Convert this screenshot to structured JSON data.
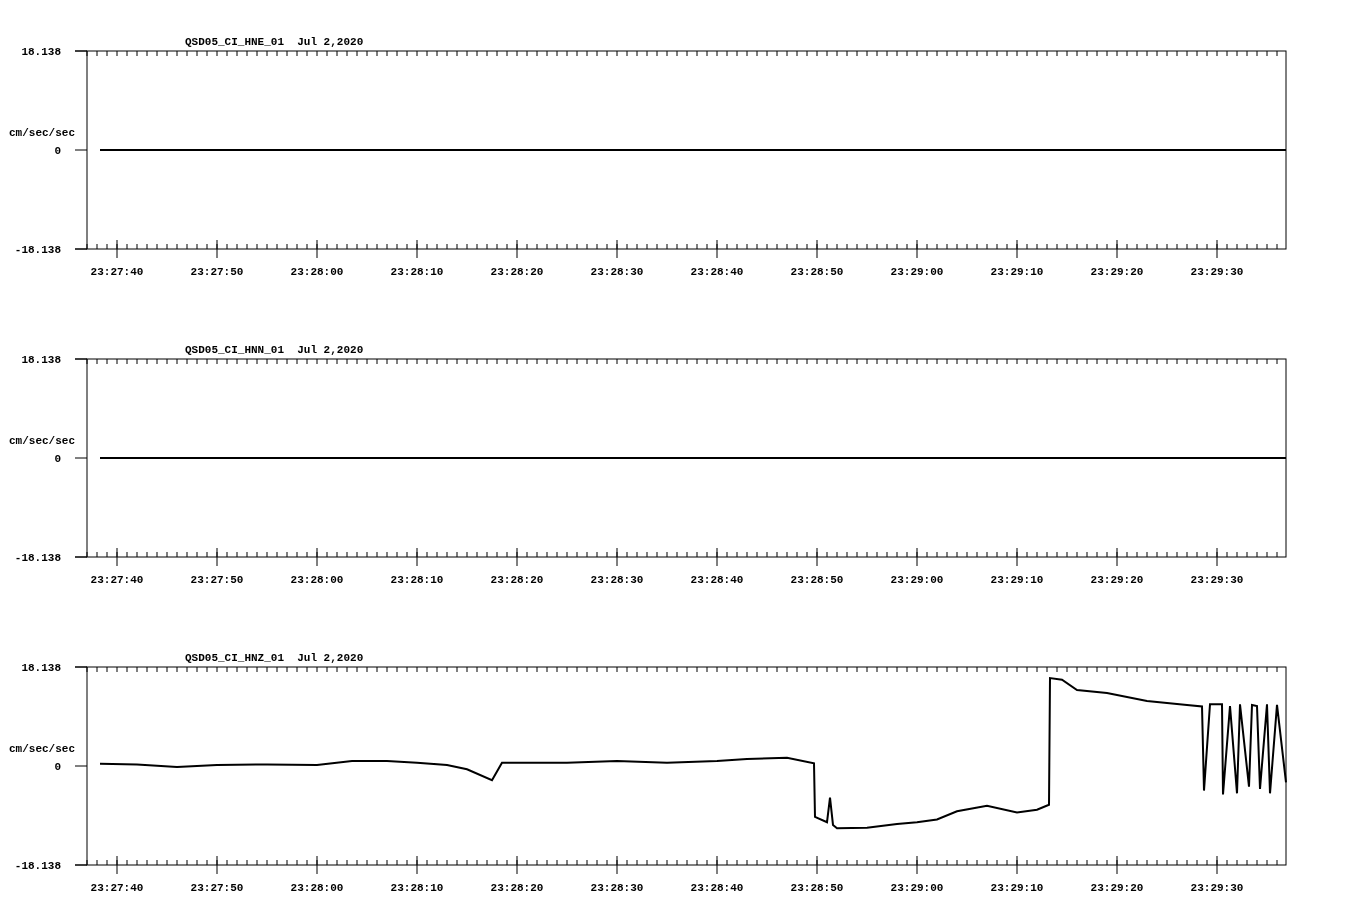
{
  "panels": [
    {
      "chart_data": {
        "type": "line",
        "title": "QSD05_CI_HNE_01  Jul 2,2020",
        "ylabel": "cm/sec/sec",
        "xlim": [
          84457,
          84576.9
        ],
        "ylim": [
          -18.138,
          18.138
        ],
        "yticks": [
          {
            "value": 18.138,
            "label": "18.138"
          },
          {
            "value": 0,
            "label": "0"
          },
          {
            "value": -18.138,
            "label": "-18.138"
          }
        ],
        "xticks": [
          {
            "value": 84460,
            "label": "23:27:40"
          },
          {
            "value": 84470,
            "label": "23:27:50"
          },
          {
            "value": 84480,
            "label": "23:28:00"
          },
          {
            "value": 84490,
            "label": "23:28:10"
          },
          {
            "value": 84500,
            "label": "23:28:20"
          },
          {
            "value": 84510,
            "label": "23:28:30"
          },
          {
            "value": 84520,
            "label": "23:28:40"
          },
          {
            "value": 84530,
            "label": "23:28:50"
          },
          {
            "value": 84540,
            "label": "23:29:00"
          },
          {
            "value": 84550,
            "label": "23:29:10"
          },
          {
            "value": 84560,
            "label": "23:29:20"
          },
          {
            "value": 84570,
            "label": "23:29:30"
          }
        ],
        "x": [
          84458.3,
          84576.9
        ],
        "series": [
          {
            "color": "#000000",
            "values": [
              0,
              0
            ]
          }
        ]
      }
    },
    {
      "chart_data": {
        "type": "line",
        "title": "QSD05_CI_HNN_01  Jul 2,2020",
        "ylabel": "cm/sec/sec",
        "xlim": [
          84457,
          84576.9
        ],
        "ylim": [
          -18.138,
          18.138
        ],
        "yticks": [
          {
            "value": 18.138,
            "label": "18.138"
          },
          {
            "value": 0,
            "label": "0"
          },
          {
            "value": -18.138,
            "label": "-18.138"
          }
        ],
        "xticks": [
          {
            "value": 84460,
            "label": "23:27:40"
          },
          {
            "value": 84470,
            "label": "23:27:50"
          },
          {
            "value": 84480,
            "label": "23:28:00"
          },
          {
            "value": 84490,
            "label": "23:28:10"
          },
          {
            "value": 84500,
            "label": "23:28:20"
          },
          {
            "value": 84510,
            "label": "23:28:30"
          },
          {
            "value": 84520,
            "label": "23:28:40"
          },
          {
            "value": 84530,
            "label": "23:28:50"
          },
          {
            "value": 84540,
            "label": "23:29:00"
          },
          {
            "value": 84550,
            "label": "23:29:10"
          },
          {
            "value": 84560,
            "label": "23:29:20"
          },
          {
            "value": 84570,
            "label": "23:29:30"
          }
        ],
        "x": [
          84458.3,
          84576.9
        ],
        "series": [
          {
            "color": "#000000",
            "values": [
              0,
              0
            ]
          }
        ]
      }
    },
    {
      "chart_data": {
        "type": "line",
        "title": "QSD05_CI_HNZ_01  Jul 2,2020",
        "ylabel": "cm/sec/sec",
        "xlim": [
          84457,
          84576.9
        ],
        "ylim": [
          -18.138,
          18.138
        ],
        "yticks": [
          {
            "value": 18.138,
            "label": "18.138"
          },
          {
            "value": 0,
            "label": "0"
          },
          {
            "value": -18.138,
            "label": "-18.138"
          }
        ],
        "xticks": [
          {
            "value": 84460,
            "label": "23:27:40"
          },
          {
            "value": 84470,
            "label": "23:27:50"
          },
          {
            "value": 84480,
            "label": "23:28:00"
          },
          {
            "value": 84490,
            "label": "23:28:10"
          },
          {
            "value": 84500,
            "label": "23:28:20"
          },
          {
            "value": 84510,
            "label": "23:28:30"
          },
          {
            "value": 84520,
            "label": "23:28:40"
          },
          {
            "value": 84530,
            "label": "23:28:50"
          },
          {
            "value": 84540,
            "label": "23:29:00"
          },
          {
            "value": 84550,
            "label": "23:29:10"
          },
          {
            "value": 84560,
            "label": "23:29:20"
          },
          {
            "value": 84570,
            "label": "23:29:30"
          }
        ],
        "x": [
          84458.3,
          84462,
          84466,
          84470,
          84475,
          84480,
          84483.5,
          84487,
          84490,
          84493,
          84495,
          84497.5,
          84498.5,
          84505,
          84510,
          84515,
          84520,
          84523,
          84527,
          84529.7,
          84529.8,
          84531,
          84531.3,
          84531.6,
          84532,
          84535,
          84538,
          84540,
          84542,
          84544,
          84547,
          84550,
          84552,
          84553.2,
          84553.3,
          84554.5,
          84556,
          84559,
          84563,
          84567,
          84568.5,
          84568.7,
          84569.3,
          84570.5,
          84570.6,
          84571.3,
          84572,
          84572.3,
          84573.2,
          84573.5,
          84574,
          84574.3,
          84575,
          84575.3,
          84576,
          84576.9
        ],
        "series": [
          {
            "color": "#000000",
            "values": [
              0.4,
              0.3,
              -0.2,
              0.2,
              0.3,
              0.2,
              0.9,
              0.9,
              0.6,
              0.2,
              -0.6,
              -2.6,
              0.6,
              0.6,
              0.9,
              0.6,
              0.9,
              1.3,
              1.5,
              0.5,
              -9.3,
              -10.3,
              -5.8,
              -10.8,
              -11.4,
              -11.3,
              -10.6,
              -10.3,
              -9.8,
              -8.3,
              -7.3,
              -8.5,
              -8.0,
              -7.1,
              16.1,
              15.8,
              13.9,
              13.4,
              11.9,
              11.2,
              10.9,
              -4.5,
              11.3,
              11.3,
              -5.2,
              11.0,
              -5.0,
              11.3,
              -3.8,
              11.2,
              11.0,
              -4.2,
              11.3,
              -5.0,
              11.2,
              -3.0
            ]
          }
        ]
      }
    }
  ]
}
